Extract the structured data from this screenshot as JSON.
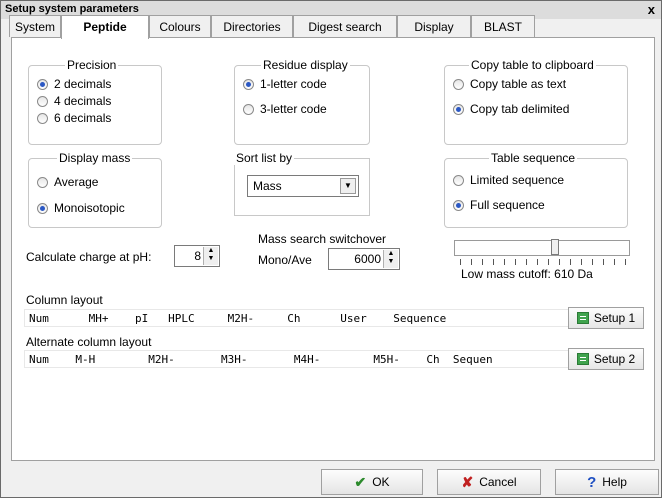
{
  "window": {
    "title": "Setup system parameters",
    "close": "x"
  },
  "tabs": [
    "System",
    "Peptide",
    "Colours",
    "Directories",
    "Digest search",
    "Display",
    "BLAST"
  ],
  "precision": {
    "label": "Precision",
    "options": [
      "2 decimals",
      "4 decimals",
      "6 decimals"
    ],
    "selected": "2 decimals"
  },
  "residue_display": {
    "label": "Residue display",
    "options": [
      "1-letter code",
      "3-letter code"
    ],
    "selected": "1-letter code"
  },
  "copy_table": {
    "label": "Copy table to clipboard",
    "options": [
      "Copy table as text",
      "Copy tab delimited"
    ],
    "selected": "Copy tab delimited"
  },
  "display_mass": {
    "label": "Display mass",
    "options": [
      "Average",
      "Monoisotopic"
    ],
    "selected": "Monoisotopic"
  },
  "sort_list": {
    "label": "Sort list by",
    "value": "Mass"
  },
  "table_sequence": {
    "label": "Table sequence",
    "options": [
      "Limited sequence",
      "Full sequence"
    ],
    "selected": "Full sequence"
  },
  "charge": {
    "label": "Calculate charge at pH:",
    "value": "8"
  },
  "mass_switch": {
    "label": "Mass search switchover",
    "sublabel": "Mono/Ave",
    "value": "6000"
  },
  "low_mass": {
    "label": "Low mass cutoff: 610 Da",
    "fraction": 0.58
  },
  "column_layout": {
    "label": "Column layout",
    "text": "Num      MH+    pI   HPLC     M2H-     Ch      User    Sequence",
    "button": "Setup 1"
  },
  "alt_column_layout": {
    "label": "Alternate column layout",
    "text": "Num    M-H        M2H-       M3H-       M4H-        M5H-    Ch  Sequen",
    "button": "Setup 2"
  },
  "buttons": {
    "ok": "OK",
    "cancel": "Cancel",
    "help": "Help"
  }
}
